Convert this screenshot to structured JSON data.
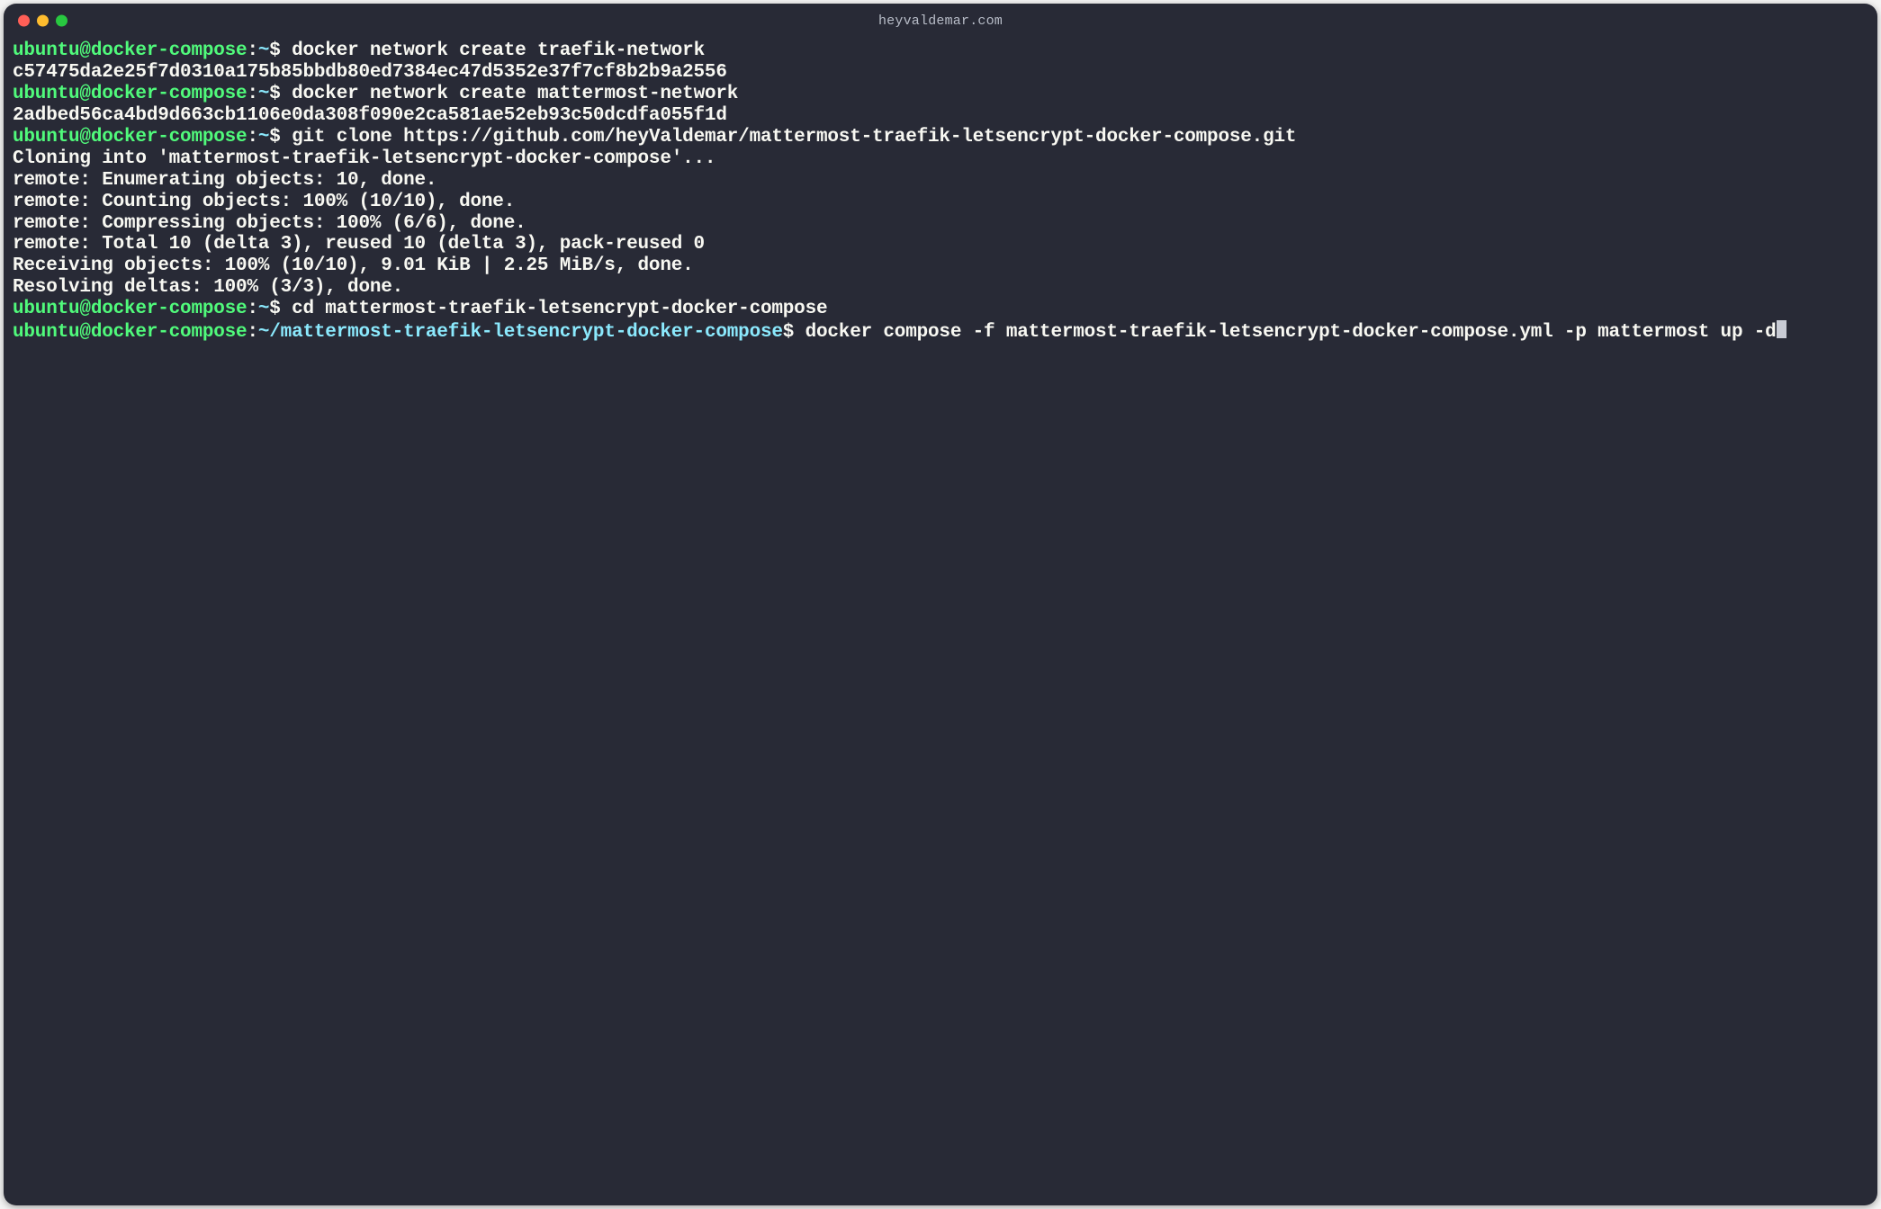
{
  "window": {
    "title": "heyvaldemar.com"
  },
  "colors": {
    "bg": "#282a36",
    "fg": "#f8f8f2",
    "user": "#50fa7b",
    "path": "#8be9fd",
    "dot_close": "#ff5f57",
    "dot_min": "#febc2e",
    "dot_max": "#28c840"
  },
  "prompt": {
    "user": "ubuntu",
    "host": "docker-compose",
    "separator": "@",
    "colon": ":",
    "symbol": "$"
  },
  "lines": [
    {
      "type": "prompt",
      "path": "~",
      "cmd": "docker network create traefik-network"
    },
    {
      "type": "out",
      "text": "c57475da2e25f7d0310a175b85bbdb80ed7384ec47d5352e37f7cf8b2b9a2556"
    },
    {
      "type": "prompt",
      "path": "~",
      "cmd": "docker network create mattermost-network"
    },
    {
      "type": "out",
      "text": "2adbed56ca4bd9d663cb1106e0da308f090e2ca581ae52eb93c50dcdfa055f1d"
    },
    {
      "type": "prompt",
      "path": "~",
      "cmd": "git clone https://github.com/heyValdemar/mattermost-traefik-letsencrypt-docker-compose.git"
    },
    {
      "type": "out",
      "text": "Cloning into 'mattermost-traefik-letsencrypt-docker-compose'..."
    },
    {
      "type": "out",
      "text": "remote: Enumerating objects: 10, done."
    },
    {
      "type": "out",
      "text": "remote: Counting objects: 100% (10/10), done."
    },
    {
      "type": "out",
      "text": "remote: Compressing objects: 100% (6/6), done."
    },
    {
      "type": "out",
      "text": "remote: Total 10 (delta 3), reused 10 (delta 3), pack-reused 0"
    },
    {
      "type": "out",
      "text": "Receiving objects: 100% (10/10), 9.01 KiB | 2.25 MiB/s, done."
    },
    {
      "type": "out",
      "text": "Resolving deltas: 100% (3/3), done."
    },
    {
      "type": "prompt",
      "path": "~",
      "cmd": "cd mattermost-traefik-letsencrypt-docker-compose"
    },
    {
      "type": "prompt",
      "path": "~/mattermost-traefik-letsencrypt-docker-compose",
      "cmd": "docker compose -f mattermost-traefik-letsencrypt-docker-compose.yml -p mattermost up -d",
      "cursor": true
    }
  ]
}
